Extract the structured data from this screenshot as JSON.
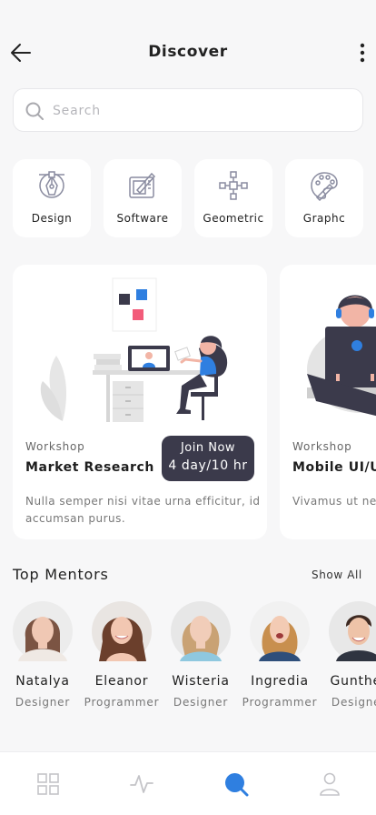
{
  "header": {
    "title": "Discover"
  },
  "search": {
    "placeholder": "Search",
    "value": ""
  },
  "categories": [
    {
      "label": "Design",
      "icon": "pen-tool-icon"
    },
    {
      "label": "Software",
      "icon": "design-tablet-icon"
    },
    {
      "label": "Geometric",
      "icon": "vector-nodes-icon"
    },
    {
      "label": "Graphc",
      "icon": "palette-icon"
    }
  ],
  "workshops": [
    {
      "type": "Workshop",
      "title": "Market Research",
      "description": "Nulla semper nisi vitae urna efficitur, id accumsan purus.",
      "join_label": "Join Now",
      "duration": "4 day/10 hr"
    },
    {
      "type": "Workshop",
      "title": "Mobile UI/UX",
      "description": "Vivamus ut ne maximus a sit"
    }
  ],
  "mentors_section": {
    "title": "Top Mentors",
    "show_all": "Show All"
  },
  "mentors": [
    {
      "name": "Natalya",
      "role": "Designer"
    },
    {
      "name": "Eleanor",
      "role": "Programmer"
    },
    {
      "name": "Wisteria",
      "role": "Designer"
    },
    {
      "name": "Ingredia",
      "role": "Programmer"
    },
    {
      "name": "Gunther",
      "role": "Designer"
    }
  ],
  "tabbar": {
    "active": "search",
    "items": [
      "grid-icon",
      "activity-icon",
      "search-icon",
      "profile-icon"
    ]
  },
  "colors": {
    "accent": "#2f7fe0",
    "dark_button": "#3b3a4b",
    "background": "#f7f7f8"
  }
}
